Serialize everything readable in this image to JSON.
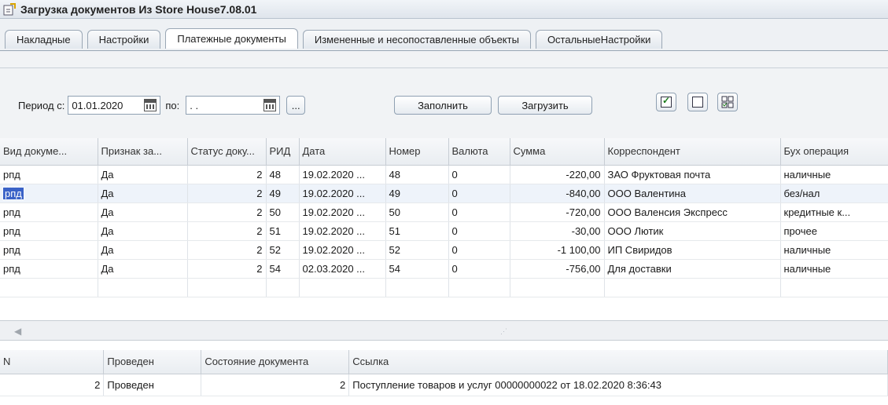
{
  "window": {
    "title": "Загрузка документов Из Store House7.08.01"
  },
  "tabs": [
    {
      "label": "Накладные",
      "active": false
    },
    {
      "label": "Настройки",
      "active": false
    },
    {
      "label": "Платежные документы",
      "active": true
    },
    {
      "label": "Измененные и несопоставленные объекты",
      "active": false
    },
    {
      "label": "ОстальныеНастройки",
      "active": false
    }
  ],
  "filter": {
    "period_from_label": "Период с:",
    "period_from_value": "01.01.2020",
    "period_to_label": "по:",
    "period_to_value": " .  .",
    "ellipsis_label": "...",
    "fill_label": "Заполнить",
    "load_label": "Загрузить"
  },
  "grid": {
    "columns": [
      "Вид докуме...",
      "Признак за...",
      "Статус доку...",
      "РИД",
      "Дата",
      "Номер",
      "Валюта",
      "Сумма",
      "Корреспондент",
      "Бух операция"
    ],
    "rows": [
      [
        "рпд",
        "Да",
        "2",
        "48",
        "19.02.2020 ...",
        "48",
        "0",
        "-220,00",
        "ЗАО Фруктовая почта",
        "наличные"
      ],
      [
        "рпд",
        "Да",
        "2",
        "49",
        "19.02.2020 ...",
        "49",
        "0",
        "-840,00",
        "ООО Валентина",
        "без/нал"
      ],
      [
        "рпд",
        "Да",
        "2",
        "50",
        "19.02.2020 ...",
        "50",
        "0",
        "-720,00",
        "ООО Валенсия Экспресс",
        "кредитные к..."
      ],
      [
        "рпд",
        "Да",
        "2",
        "51",
        "19.02.2020 ...",
        "51",
        "0",
        "-30,00",
        "ООО Лютик",
        "прочее"
      ],
      [
        "рпд",
        "Да",
        "2",
        "52",
        "19.02.2020 ...",
        "52",
        "0",
        "-1 100,00",
        "ИП Свиридов",
        "наличные"
      ],
      [
        "рпд",
        "Да",
        "2",
        "54",
        "02.03.2020 ...",
        "54",
        "0",
        "-756,00",
        "Для доставки",
        "наличные"
      ]
    ],
    "selected_row": 1
  },
  "details": {
    "columns": [
      "N",
      "Проведен",
      "Состояние документа",
      "Ссылка"
    ],
    "rows": [
      [
        "2",
        "Проведен",
        "2",
        "Поступление товаров и услуг 00000000022 от 18.02.2020 8:36:43"
      ]
    ]
  }
}
